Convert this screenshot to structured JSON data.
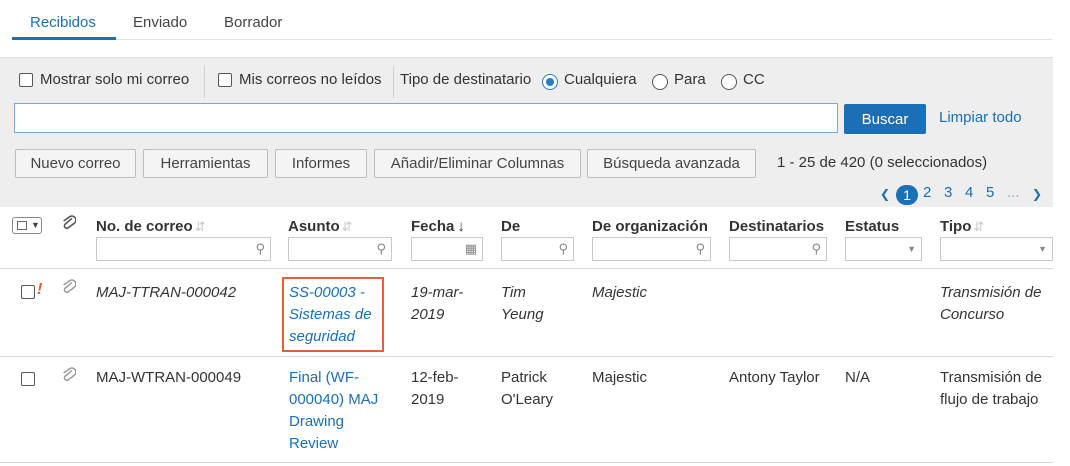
{
  "tabs": [
    {
      "label": "Recibidos",
      "active": true
    },
    {
      "label": "Enviado",
      "active": false
    },
    {
      "label": "Borrador",
      "active": false
    }
  ],
  "filters": {
    "only_my_mail": "Mostrar solo mi correo",
    "unread": "Mis correos no leídos",
    "recipient_type_label": "Tipo de destinatario",
    "options": [
      "Cualquiera",
      "Para",
      "CC"
    ],
    "selected_option": "Cualquiera"
  },
  "search": {
    "value": "",
    "placeholder": "",
    "button": "Buscar",
    "clear_link": "Limpiar todo"
  },
  "toolbar": {
    "new_mail": "Nuevo correo",
    "tools": "Herramientas",
    "reports": "Informes",
    "columns": "Añadir/Eliminar Columnas",
    "advanced": "Búsqueda avanzada",
    "count": "1 - 25 de 420 (0 seleccionados)"
  },
  "pagination": {
    "prev": "❮",
    "pages": [
      "1",
      "2",
      "3",
      "4",
      "5"
    ],
    "ellipsis": "...",
    "next": "❯",
    "current": "1"
  },
  "columns": {
    "mail_no": "No. de correo",
    "subject": "Asunto",
    "date": "Fecha",
    "from": "De",
    "from_org": "De organización",
    "recipients": "Destinatarios",
    "status": "Estatus",
    "type": "Tipo"
  },
  "rows": [
    {
      "mail_no": "MAJ-TTRAN-000042",
      "subject": [
        "SS-00003 -",
        "Sistemas de",
        "seguridad"
      ],
      "date": [
        "19-mar-",
        "2019"
      ],
      "from": [
        "Tim",
        "Yeung"
      ],
      "from_org": "Majestic",
      "recipients": "",
      "status": "",
      "type": [
        "Transmisión de",
        "Concurso"
      ],
      "unread": true,
      "important": true
    },
    {
      "mail_no": "MAJ-WTRAN-000049",
      "subject": [
        "Final (WF-",
        "000040) MAJ",
        "Drawing",
        "Review"
      ],
      "date": [
        "12-feb-",
        "2019"
      ],
      "from": [
        "Patrick",
        "O'Leary"
      ],
      "from_org": "Majestic",
      "recipients": "Antony Taylor",
      "status": "N/A",
      "type": [
        "Transmisión de",
        "flujo de trabajo"
      ],
      "unread": false,
      "important": false
    }
  ],
  "colors": {
    "accent": "#1a6fb5",
    "highlight": "#e0603a",
    "panel": "#eeeeee"
  }
}
